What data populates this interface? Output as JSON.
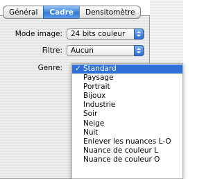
{
  "tabs": [
    {
      "label": "Général",
      "active": false
    },
    {
      "label": "Cadre",
      "active": true
    },
    {
      "label": "Densitomètre",
      "active": false
    }
  ],
  "mode_image": {
    "label": "Mode image:",
    "value": "24 bits couleur"
  },
  "filtre": {
    "label": "Filtre:",
    "value": "Aucun"
  },
  "genre": {
    "label": "Genre:",
    "check_mark": "✓",
    "options": [
      "Standard",
      "Paysage",
      "Portrait",
      "Bijoux",
      "Industrie",
      "Soir",
      "Neige",
      "Nuit",
      "Enlever les nuances L-O",
      "Nuance de couleur L",
      "Nuance de couleur O"
    ],
    "selected": "Standard"
  },
  "colors": {
    "accent": "#2f6fd6"
  }
}
